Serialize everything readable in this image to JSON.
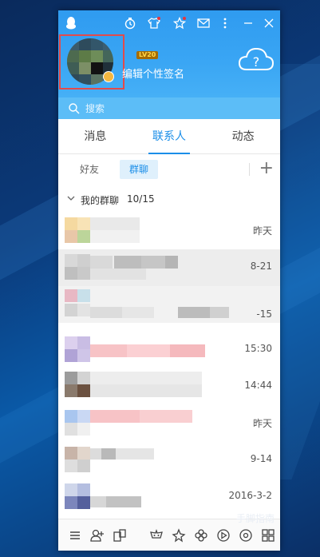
{
  "window": {
    "level_badge": "LV20",
    "signature_placeholder": "编辑个性签名",
    "search_placeholder": "搜索"
  },
  "tabs": [
    {
      "label": "消息"
    },
    {
      "label": "联系人"
    },
    {
      "label": "动态"
    }
  ],
  "subtabs": [
    {
      "label": "好友"
    },
    {
      "label": "群聊"
    }
  ],
  "group": {
    "name": "我的群聊",
    "count": "10/15"
  },
  "rows": [
    {
      "date": "昨天"
    },
    {
      "date": "8-21"
    },
    {
      "date": "-15"
    },
    {
      "date": "15:30"
    },
    {
      "date": "14:44"
    },
    {
      "date": "昨天"
    },
    {
      "date": "9-14"
    },
    {
      "date": "2016-3-2"
    }
  ],
  "watermark": "手脚指南",
  "colors": {
    "header_blue": "#2f9bf0",
    "accent": "#1b8ee8",
    "avatar_border": "#e24b4b"
  },
  "icons": [
    "qq-penguin-icon",
    "tasks-icon",
    "shirt-icon",
    "star-icon",
    "mail-icon",
    "more-icon",
    "minimize-icon",
    "close-icon",
    "cloud-icon",
    "search-icon",
    "menu-icon",
    "add-friend-icon",
    "app-manager-icon",
    "game-icon",
    "game-center-icon",
    "pinwheel-icon",
    "video-icon",
    "music-icon",
    "apps-icon"
  ]
}
